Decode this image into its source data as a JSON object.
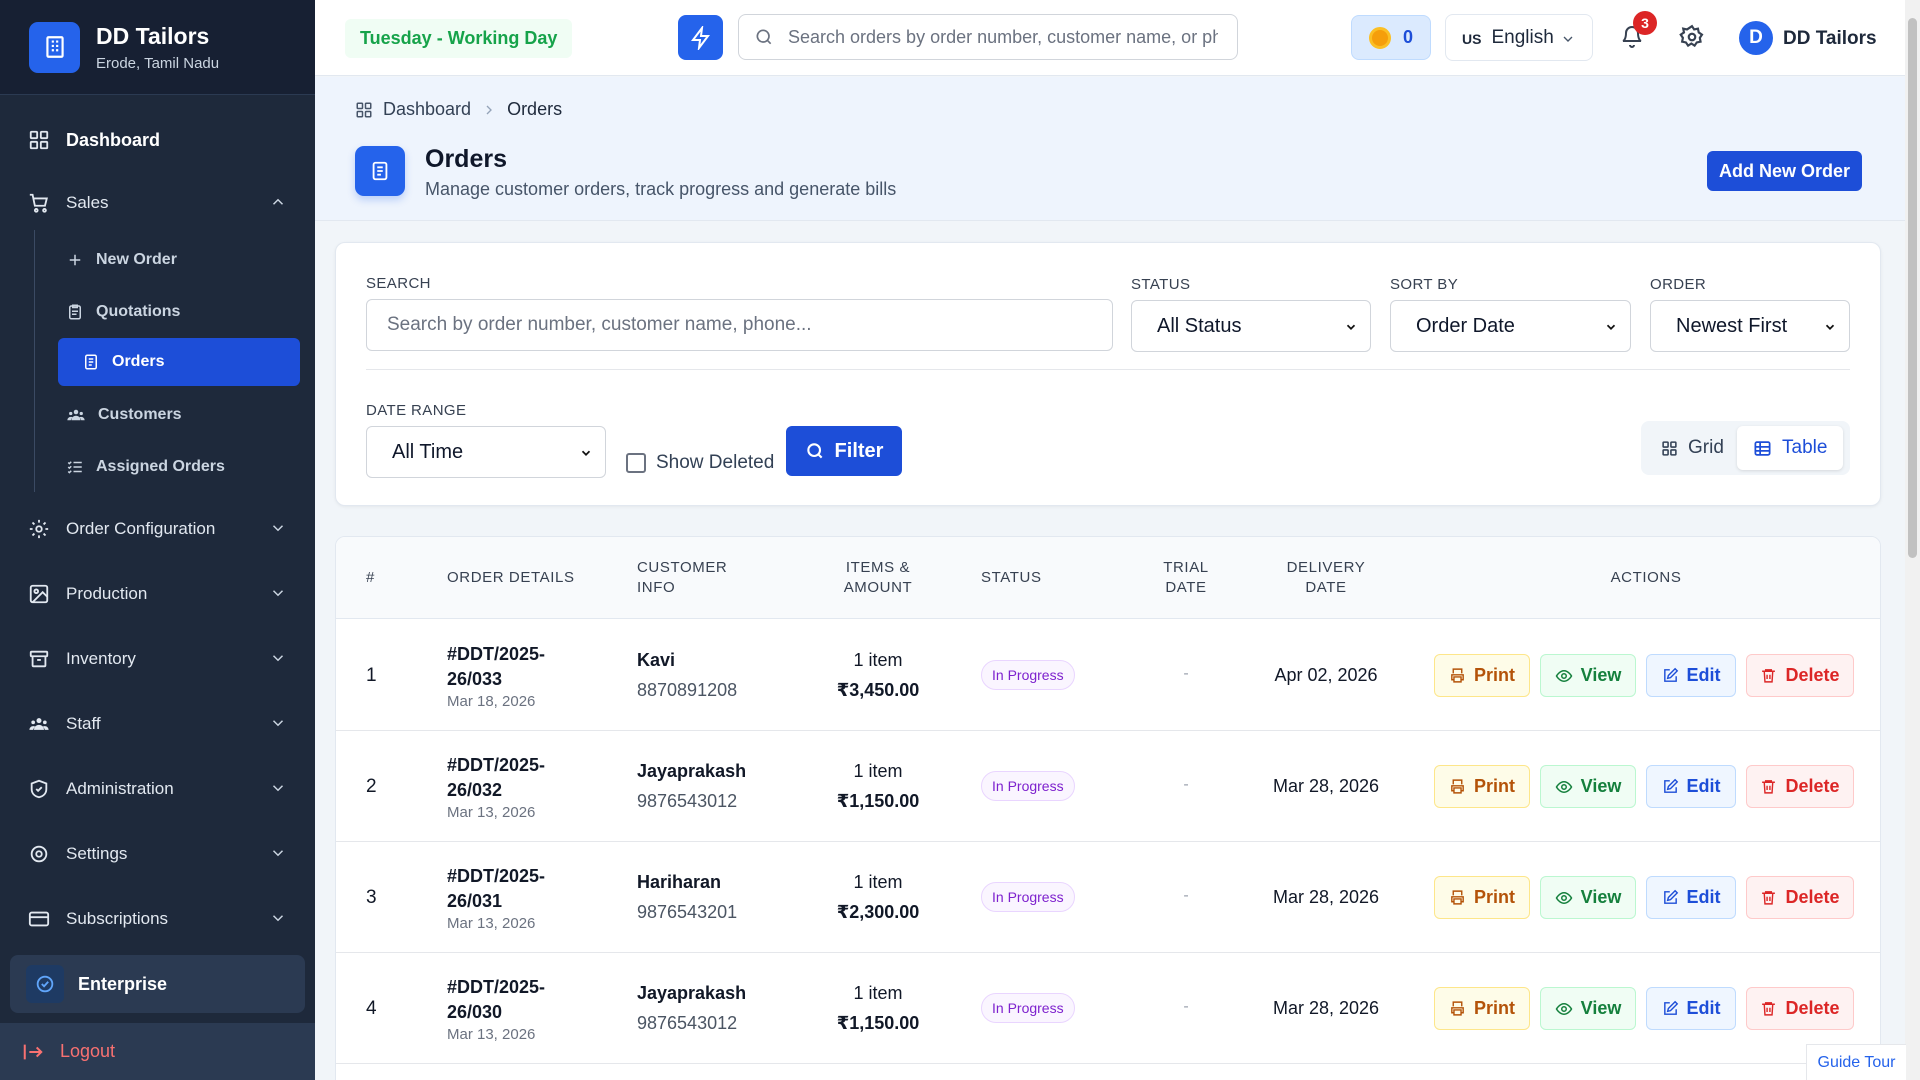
{
  "brand": {
    "name": "DD Tailors",
    "location": "Erode, Tamil Nadu"
  },
  "sidebar": {
    "dashboard": "Dashboard",
    "sales": "Sales",
    "sales_items": [
      "New Order",
      "Quotations",
      "Orders",
      "Customers",
      "Assigned Orders"
    ],
    "active_item": "Orders",
    "groups": [
      "Order Configuration",
      "Production",
      "Inventory",
      "Staff",
      "Administration",
      "Settings",
      "Subscriptions"
    ],
    "plan": "Enterprise",
    "logout": "Logout"
  },
  "header": {
    "day_status": "Tuesday - Working Day",
    "search_placeholder": "Search orders by order number, customer name, or phone",
    "coins": "0",
    "language_flag": "US",
    "language": "English",
    "notifications": "3",
    "user_initial": "D",
    "user_name": "DD Tailors"
  },
  "page": {
    "breadcrumb": [
      "Dashboard",
      "Orders"
    ],
    "title": "Orders",
    "subtitle": "Manage customer orders, track progress and generate bills",
    "add_button": "Add New Order"
  },
  "filters": {
    "search_label": "SEARCH",
    "search_placeholder": "Search by order number, customer name, phone...",
    "status_label": "STATUS",
    "status_value": "All Status",
    "sort_label": "SORT BY",
    "sort_value": "Order Date",
    "order_label": "ORDER",
    "order_value": "Newest First",
    "date_label": "DATE RANGE",
    "date_value": "All Time",
    "show_deleted": "Show Deleted",
    "show_deleted_checked": false,
    "filter_button": "Filter",
    "view_grid": "Grid",
    "view_table": "Table",
    "active_view": "Table"
  },
  "table": {
    "columns": [
      "#",
      "ORDER DETAILS",
      "CUSTOMER INFO",
      "ITEMS & AMOUNT",
      "STATUS",
      "TRIAL DATE",
      "DELIVERY DATE",
      "ACTIONS"
    ],
    "actions": {
      "print": "Print",
      "view": "View",
      "edit": "Edit",
      "delete": "Delete"
    },
    "rows": [
      {
        "num": "1",
        "order_no": "#DDT/2025-26/033",
        "order_date": "Mar 18, 2026",
        "customer": "Kavi",
        "phone": "8870891208",
        "items": "1 item",
        "amount": "₹3,450.00",
        "status": "In Progress",
        "trial": "-",
        "delivery": "Apr 02, 2026"
      },
      {
        "num": "2",
        "order_no": "#DDT/2025-26/032",
        "order_date": "Mar 13, 2026",
        "customer": "Jayaprakash",
        "phone": "9876543012",
        "items": "1 item",
        "amount": "₹1,150.00",
        "status": "In Progress",
        "trial": "-",
        "delivery": "Mar 28, 2026"
      },
      {
        "num": "3",
        "order_no": "#DDT/2025-26/031",
        "order_date": "Mar 13, 2026",
        "customer": "Hariharan",
        "phone": "9876543201",
        "items": "1 item",
        "amount": "₹2,300.00",
        "status": "In Progress",
        "trial": "-",
        "delivery": "Mar 28, 2026"
      },
      {
        "num": "4",
        "order_no": "#DDT/2025-26/030",
        "order_date": "Mar 13, 2026",
        "customer": "Jayaprakash",
        "phone": "9876543012",
        "items": "1 item",
        "amount": "₹1,150.00",
        "status": "In Progress",
        "trial": "-",
        "delivery": "Mar 28, 2026"
      }
    ]
  },
  "guide_tour": "Guide Tour",
  "colors": {
    "primary": "#2563eb",
    "sidebar": "#1e293b",
    "status_purple": "#7e22ce",
    "success": "#16a34a",
    "danger": "#dc2626"
  }
}
